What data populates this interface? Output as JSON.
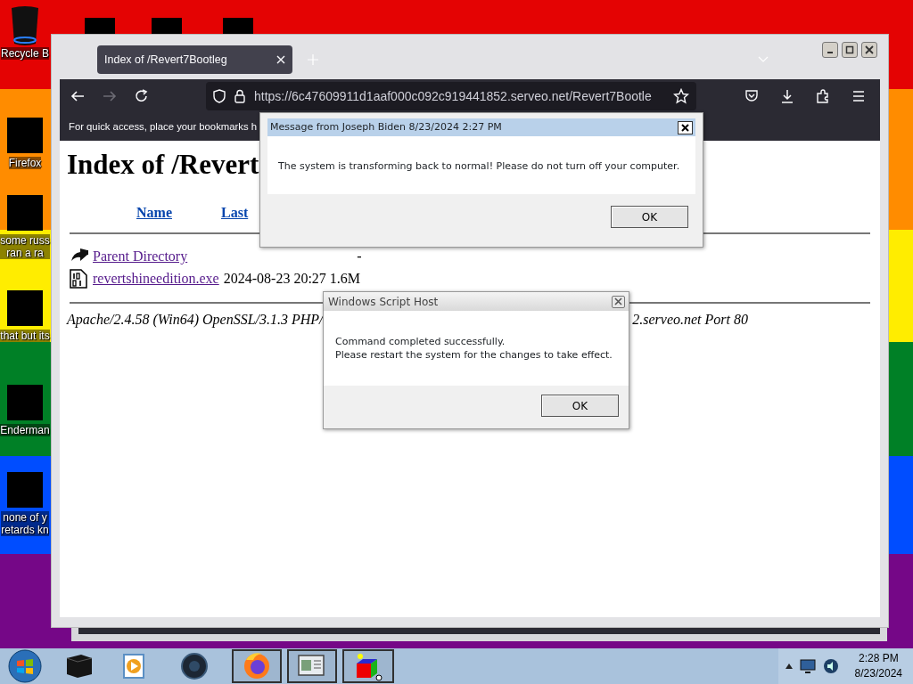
{
  "desktop_icons": [
    {
      "kind": "bin",
      "lines": [
        "Recycle B"
      ]
    },
    {
      "kind": "redacted",
      "lines": [
        "Firefox"
      ]
    },
    {
      "kind": "redacted",
      "lines": [
        "some russ",
        "ran a ra"
      ]
    },
    {
      "kind": "redacted",
      "lines": [
        "that but its"
      ]
    },
    {
      "kind": "redacted",
      "lines": [
        "Enderman"
      ]
    },
    {
      "kind": "redacted",
      "lines": [
        "none of y",
        "retards kn"
      ]
    }
  ],
  "browser": {
    "tab_title": "Index of /Revert7Bootleg",
    "nav_buttons": [
      {
        "kind": "back",
        "disabled": false
      },
      {
        "kind": "forward",
        "disabled": true
      },
      {
        "kind": "reload",
        "disabled": false
      }
    ],
    "url": "https://6c47609911d1aaf000c092c919441852.serveo.net/Revert7Bootle",
    "bookmarks_hint": "For quick access, place your bookmarks h",
    "page": {
      "heading": "Index of /Revert",
      "columns": [
        {
          "label": "Name",
          "visited": false
        },
        {
          "label": "Last",
          "visited": false
        }
      ],
      "entries": [
        {
          "kind": "parent",
          "name": "Parent Directory",
          "visited": true,
          "details": "-"
        },
        {
          "kind": "binary",
          "name": "revertshineedition.exe",
          "visited": true,
          "details": "2024-08-23 20:27 1.6M"
        }
      ],
      "footer": [
        "Apache/2.4.58 (Win64) OpenSSL/3.1.3 PHP/",
        "2.serveo.net Port 80"
      ]
    }
  },
  "dialogs": [
    {
      "kind": "classic",
      "title": "Message from Joseph Biden 8/23/2024 2:27 PM",
      "lines": [
        "The system is transforming back to normal! Please do not turn off your computer."
      ],
      "button": "OK"
    },
    {
      "kind": "aero",
      "title": "Windows Script Host",
      "lines": [
        "Command completed successfully.",
        "Please restart the system for the changes to take effect."
      ],
      "button": "OK"
    }
  ],
  "taskbar": {
    "items": [
      {
        "kind": "box",
        "running": false
      },
      {
        "kind": "media",
        "running": false
      },
      {
        "kind": "sphere",
        "running": false
      },
      {
        "kind": "firefox",
        "running": true
      },
      {
        "kind": "window",
        "running": true
      },
      {
        "kind": "cube",
        "running": true
      }
    ],
    "clock": {
      "time": "2:28 PM",
      "date": "8/23/2024"
    }
  }
}
